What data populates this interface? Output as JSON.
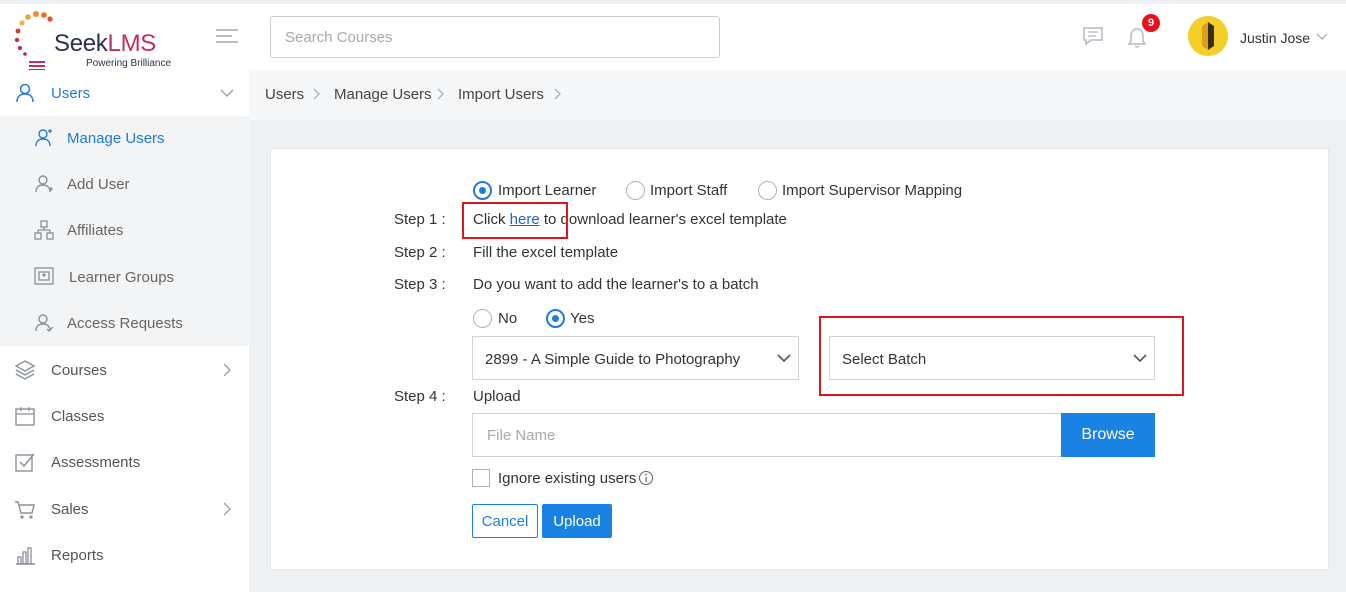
{
  "brand": {
    "name_part1": "Seek",
    "name_part2": "LMS",
    "tagline": "Powering Brilliance",
    "accent_color": "#c0305a"
  },
  "header": {
    "search_placeholder": "Search Courses",
    "notification_count": "9",
    "user_name": "Justin Jose"
  },
  "sidebar": {
    "users": {
      "label": "Users",
      "icon": "users-icon"
    },
    "sub_items": [
      {
        "label": "Manage Users",
        "icon": "user-manage-icon",
        "active": true
      },
      {
        "label": "Add User",
        "icon": "add-user-icon"
      },
      {
        "label": "Affiliates",
        "icon": "affiliates-icon"
      },
      {
        "label": "Learner Groups",
        "icon": "groups-icon"
      },
      {
        "label": "Access Requests",
        "icon": "access-request-icon"
      }
    ],
    "items": [
      {
        "label": "Courses",
        "icon": "layers-icon",
        "has_children": true
      },
      {
        "label": "Classes",
        "icon": "calendar-icon"
      },
      {
        "label": "Assessments",
        "icon": "checkbox-icon"
      },
      {
        "label": "Sales",
        "icon": "cart-icon",
        "has_children": true
      },
      {
        "label": "Reports",
        "icon": "bar-chart-icon"
      }
    ]
  },
  "breadcrumb": {
    "items": [
      "Users",
      "Manage Users",
      "Import Users"
    ]
  },
  "form": {
    "import_types": [
      "Import Learner",
      "Import Staff",
      "Import Supervisor Mapping"
    ],
    "selected_import_type": "Import Learner",
    "step1_label": "Step 1 :",
    "step1_prefix": "Click ",
    "step1_link": "here",
    "step1_suffix": " to download learner's excel template",
    "step2_label": "Step 2 :",
    "step2_text": "Fill the excel template",
    "step3_label": "Step 3 :",
    "step3_text": "Do you want to add the learner's to a batch",
    "batch_options": [
      "No",
      "Yes"
    ],
    "selected_batch_option": "Yes",
    "course_select_value": "2899 - A Simple Guide to Photography",
    "batch_select_value": "Select Batch",
    "step4_label": "Step 4 :",
    "step4_text": "Upload",
    "file_placeholder": "File Name",
    "browse_label": "Browse",
    "ignore_label": "Ignore existing users",
    "cancel_label": "Cancel",
    "upload_label": "Upload"
  },
  "colors": {
    "primary": "#1a82e2",
    "highlight": "#e0141e",
    "badge": "#e8101f"
  }
}
